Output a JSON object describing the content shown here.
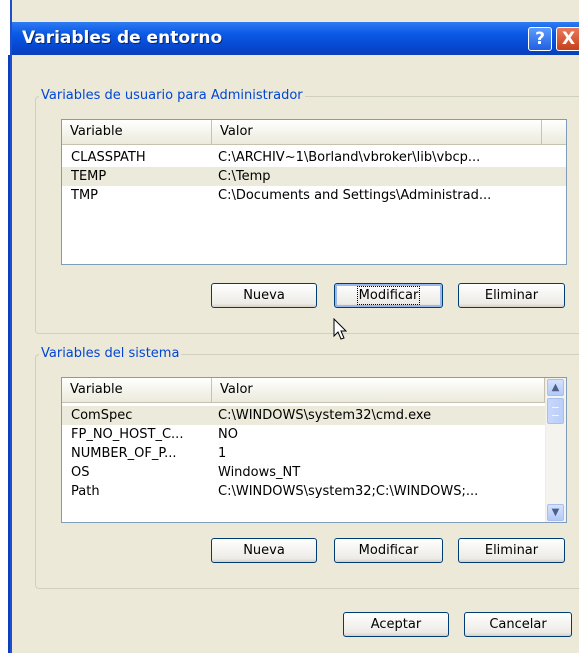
{
  "window": {
    "title": "Variables de entorno"
  },
  "title_buttons": {
    "help": "?",
    "close": "X"
  },
  "user_group": {
    "label": "Variables de usuario para Administrador",
    "columns": [
      "Variable",
      "Valor"
    ],
    "rows": [
      {
        "name": "CLASSPATH",
        "value": "C:\\ARCHIV~1\\Borland\\vbroker\\lib\\vbcp...",
        "selected": false
      },
      {
        "name": "TEMP",
        "value": "C:\\Temp",
        "selected": true
      },
      {
        "name": "TMP",
        "value": "C:\\Documents and Settings\\Administrad...",
        "selected": false
      }
    ],
    "buttons": {
      "new": "Nueva",
      "edit": "Modificar",
      "delete": "Eliminar"
    }
  },
  "system_group": {
    "label": "Variables del sistema",
    "columns": [
      "Variable",
      "Valor"
    ],
    "rows": [
      {
        "name": "ComSpec",
        "value": "C:\\WINDOWS\\system32\\cmd.exe",
        "selected": true
      },
      {
        "name": "FP_NO_HOST_C...",
        "value": "NO",
        "selected": false
      },
      {
        "name": "NUMBER_OF_P...",
        "value": "1",
        "selected": false
      },
      {
        "name": "OS",
        "value": "Windows_NT",
        "selected": false
      },
      {
        "name": "Path",
        "value": "C:\\WINDOWS\\system32;C:\\WINDOWS;...",
        "selected": false
      }
    ],
    "buttons": {
      "new": "Nueva",
      "edit": "Modificar",
      "delete": "Eliminar"
    }
  },
  "footer": {
    "ok": "Aceptar",
    "cancel": "Cancelar"
  },
  "colors": {
    "title_bar": "#0648d0",
    "group_label": "#0046d5",
    "face": "#ece9d8"
  },
  "icons": [
    "help-icon",
    "close-icon",
    "scroll-up-icon",
    "scroll-down-icon",
    "mouse-cursor-icon"
  ]
}
